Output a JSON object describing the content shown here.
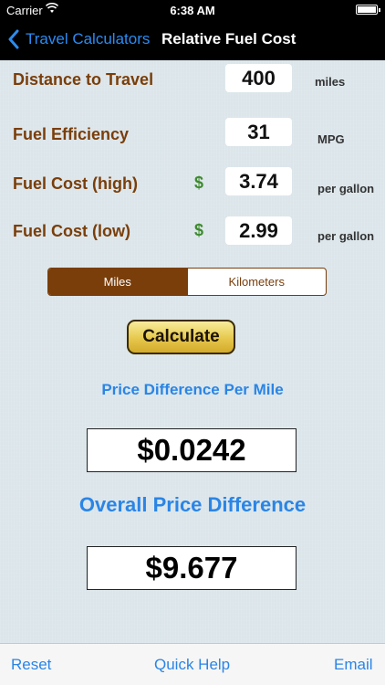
{
  "status_bar": {
    "carrier": "Carrier",
    "time": "6:38 AM"
  },
  "nav": {
    "back_label": "Travel Calculators",
    "title": "Relative Fuel Cost"
  },
  "form": {
    "distance": {
      "label": "Distance to Travel",
      "value": "400",
      "unit": "miles"
    },
    "efficiency": {
      "label": "Fuel Efficiency",
      "value": "31",
      "unit": "MPG"
    },
    "cost_high": {
      "label": "Fuel Cost (high)",
      "currency": "$",
      "value": "3.74",
      "unit": "per gallon"
    },
    "cost_low": {
      "label": "Fuel Cost (low)",
      "currency": "$",
      "value": "2.99",
      "unit": "per gallon"
    }
  },
  "units_toggle": {
    "options": [
      "Miles",
      "Kilometers"
    ],
    "selected": "Miles"
  },
  "calculate_label": "Calculate",
  "results": {
    "per_mile_caption": "Price Difference Per Mile",
    "per_mile_value": "$0.0242",
    "overall_caption": "Overall Price Difference",
    "overall_value": "$9.677"
  },
  "toolbar": {
    "reset": "Reset",
    "quick_help": "Quick Help",
    "email": "Email"
  },
  "colors": {
    "accent_blue": "#2a85e6",
    "label_brown": "#7a3e0a",
    "currency_green": "#3d8a2d",
    "button_gold": "#e6c84d"
  }
}
